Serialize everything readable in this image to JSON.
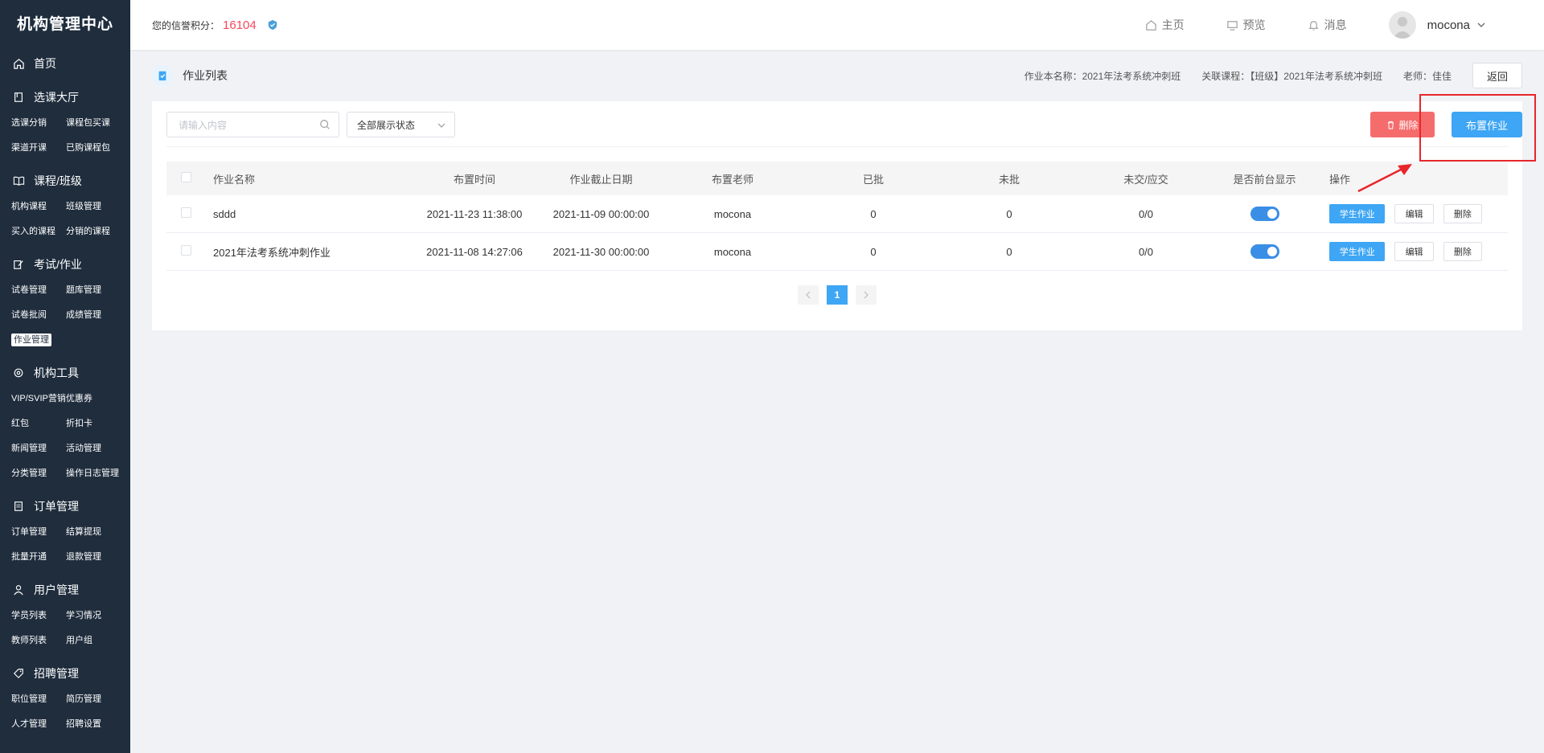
{
  "sidebar": {
    "brand": "机构管理中心",
    "home": "首页",
    "sections": [
      {
        "title": "选课大厅",
        "icon": "book-icon",
        "items": [
          "选课分销",
          "课程包买课",
          "渠道开课",
          "已购课程包"
        ]
      },
      {
        "title": "课程/班级",
        "icon": "book-open-icon",
        "items": [
          "机构课程",
          "班级管理",
          "买入的课程",
          "分销的课程"
        ]
      },
      {
        "title": "考试/作业",
        "icon": "edit-icon",
        "items": [
          "试卷管理",
          "题库管理",
          "试卷批阅",
          "成绩管理",
          "作业管理"
        ]
      },
      {
        "title": "机构工具",
        "icon": "gear-icon",
        "items": [
          "VIP/SVIP营销优惠券",
          "红包",
          "折扣卡",
          "新闻管理",
          "活动管理",
          "分类管理",
          "操作日志管理"
        ]
      },
      {
        "title": "订单管理",
        "icon": "order-icon",
        "items": [
          "订单管理",
          "结算提现",
          "批量开通",
          "退款管理"
        ]
      },
      {
        "title": "用户管理",
        "icon": "user-icon",
        "items": [
          "学员列表",
          "学习情况",
          "教师列表",
          "用户组"
        ]
      },
      {
        "title": "招聘管理",
        "icon": "tag-icon",
        "items": [
          "职位管理",
          "简历管理",
          "人才管理",
          "招聘设置"
        ]
      }
    ],
    "active_item": "作业管理"
  },
  "header": {
    "credit_label": "您的信誉积分：",
    "credit_value": "16104",
    "nav": {
      "home": "主页",
      "preview": "预览",
      "messages": "消息"
    },
    "username": "mocona"
  },
  "page": {
    "title": "作业列表",
    "meta_assignment": "作业本名称：2021年法考系统冲刺班",
    "meta_course": "关联课程：【班级】2021年法考系统冲刺班",
    "meta_teacher": "老师：佳佳",
    "back": "返回"
  },
  "toolbar": {
    "search_placeholder": "请输入内容",
    "status_select": "全部展示状态",
    "delete": "删除",
    "assign": "布置作业"
  },
  "table": {
    "headers": {
      "name": "作业名称",
      "time": "布置时间",
      "deadline": "作业截止日期",
      "teacher": "布置老师",
      "graded": "已批",
      "ungraded": "未批",
      "submission": "未交/应交",
      "display": "是否前台显示",
      "ops": "操作"
    },
    "rows": [
      {
        "name": "sddd",
        "time": "2021-11-23 11:38:00",
        "deadline": "2021-11-09 00:00:00",
        "teacher": "mocona",
        "graded": "0",
        "ungraded": "0",
        "submission": "0/0",
        "display": true
      },
      {
        "name": "2021年法考系统冲刺作业",
        "time": "2021-11-08 14:27:06",
        "deadline": "2021-11-30 00:00:00",
        "teacher": "mocona",
        "graded": "0",
        "ungraded": "0",
        "submission": "0/0",
        "display": true
      }
    ],
    "op_labels": {
      "student": "学生作业",
      "edit": "编辑",
      "delete": "删除"
    }
  },
  "pagination": {
    "current": "1"
  },
  "colors": {
    "accent": "#3ea6f4",
    "danger": "#f56c6c",
    "sidebar": "#1f2d3d",
    "credit": "#f5475b",
    "annotation": "#e8262b"
  }
}
